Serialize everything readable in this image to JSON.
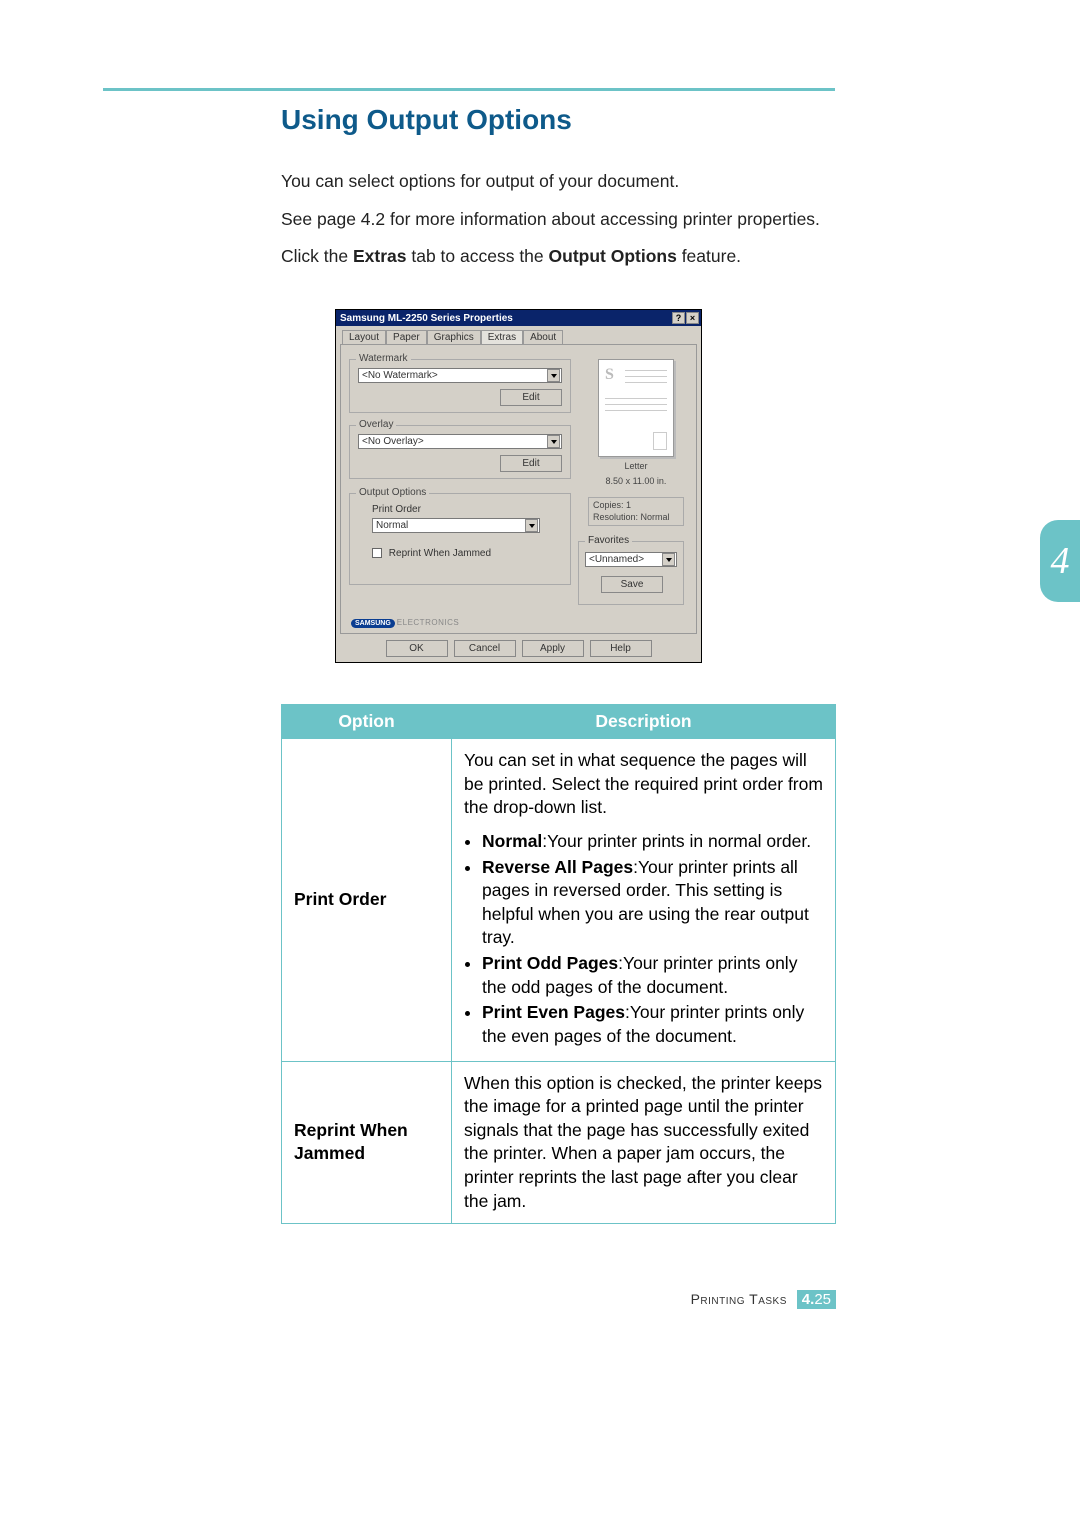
{
  "heading": "Using Output Options",
  "body": {
    "p1": "You can select options for output of your document.",
    "p2": "See page 4.2 for more information about accessing printer properties.",
    "p3_pre": "Click the ",
    "p3_b1": "Extras",
    "p3_mid": " tab to access the ",
    "p3_b2": "Output Options",
    "p3_post": " feature."
  },
  "dialog": {
    "title": "Samsung ML-2250 Series Properties",
    "help_btn": "?",
    "close_btn": "×",
    "tabs": [
      "Layout",
      "Paper",
      "Graphics",
      "Extras",
      "About"
    ],
    "active_tab": "Extras",
    "watermark": {
      "label": "Watermark",
      "value": "<No Watermark>",
      "edit": "Edit"
    },
    "overlay": {
      "label": "Overlay",
      "value": "<No Overlay>",
      "edit": "Edit"
    },
    "output": {
      "label": "Output Options",
      "print_order_label": "Print Order",
      "print_order_value": "Normal",
      "reprint_label": "Reprint When Jammed"
    },
    "preview": {
      "paper": "Letter",
      "size": "8.50 x 11.00 in."
    },
    "info": {
      "copies": "Copies: 1",
      "resolution": "Resolution: Normal"
    },
    "favorites": {
      "label": "Favorites",
      "value": "<Unnamed>",
      "save": "Save"
    },
    "brand": "ELECTRONICS",
    "brand_logo": "SAMSUNG",
    "buttons": {
      "ok": "OK",
      "cancel": "Cancel",
      "apply": "Apply",
      "help": "Help"
    }
  },
  "chapter_thumb": "4",
  "table": {
    "headers": [
      "Option",
      "Description"
    ],
    "row1": {
      "name": "Print Order",
      "intro": "You can set in what sequence the pages will be printed. Select the required print order from the drop-down list.",
      "items": [
        {
          "b": "Normal",
          "t": ":Your printer prints in normal order."
        },
        {
          "b": "Reverse All Pages",
          "t": ":Your printer prints all pages in reversed order. This setting is helpful when you are using the rear output tray."
        },
        {
          "b": "Print Odd Pages",
          "t": ":Your printer prints only the odd pages of the document."
        },
        {
          "b": "Print Even Pages",
          "t": ":Your printer prints only the even pages of the document."
        }
      ]
    },
    "row2": {
      "name": "Reprint When Jammed",
      "desc": "When this option is checked, the printer keeps the image for a printed page until the printer signals that the page has successfully exited the printer. When a paper jam occurs, the printer reprints the last page after you clear the jam."
    }
  },
  "footer": {
    "section": "Printing Tasks",
    "chapter": "4.",
    "page": "25"
  }
}
